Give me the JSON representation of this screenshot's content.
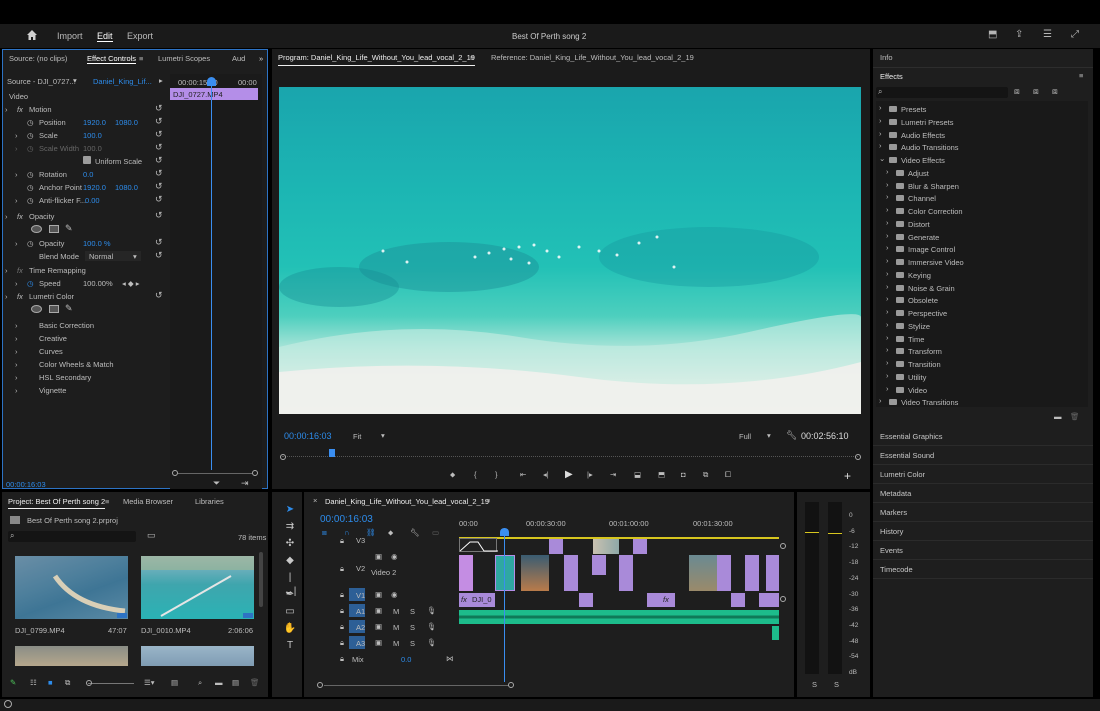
{
  "menu": {
    "import": "Import",
    "edit": "Edit",
    "export": "Export",
    "title": "Best Of Perth song 2"
  },
  "source_panel": {
    "tabs": [
      "Source: (no clips)",
      "Effect Controls",
      "Lumetri Scopes",
      "Aud"
    ],
    "source_label": "Source - DJI_0727...",
    "sequence_label": "Daniel_King_Lif...",
    "ruler_time_1": "00:00:15:00",
    "ruler_time_2": "00:00",
    "clip_name": "DJI_0727.MP4",
    "video_header": "Video",
    "motion": "Motion",
    "position_label": "Position",
    "position_x": "1920.0",
    "position_y": "1080.0",
    "scale_label": "Scale",
    "scale_val": "100.0",
    "scale_width_label": "Scale Width",
    "scale_width_val": "100.0",
    "uniform_scale": "Uniform Scale",
    "rotation_label": "Rotation",
    "rotation_val": "0.0",
    "anchor_label": "Anchor Point",
    "anchor_x": "1920.0",
    "anchor_y": "1080.0",
    "antiflicker_label": "Anti-flicker F...",
    "antiflicker_val": "0.00",
    "opacity_header": "Opacity",
    "opacity_label": "Opacity",
    "opacity_val": "100.0 %",
    "blend_label": "Blend Mode",
    "blend_val": "Normal",
    "time_remap": "Time Remapping",
    "speed_label": "Speed",
    "speed_val": "100.00%",
    "lumetri": "Lumetri Color",
    "basic": "Basic Correction",
    "creative": "Creative",
    "curves": "Curves",
    "wheels": "Color Wheels & Match",
    "hsl": "HSL Secondary",
    "vignette": "Vignette",
    "timecode": "00:00:16:03"
  },
  "program": {
    "tab": "Program: Daniel_King_Life_Without_You_lead_vocal_2_19",
    "reference_tab": "Reference: Daniel_King_Life_Without_You_lead_vocal_2_19",
    "timecode": "00:00:16:03",
    "fit": "Fit",
    "quality": "Full",
    "duration": "00:02:56:10"
  },
  "right_panel": {
    "info": "Info",
    "effects": "Effects",
    "tree": [
      {
        "label": "Presets",
        "level": 0
      },
      {
        "label": "Lumetri Presets",
        "level": 0
      },
      {
        "label": "Audio Effects",
        "level": 0
      },
      {
        "label": "Audio Transitions",
        "level": 0
      },
      {
        "label": "Video Effects",
        "level": 0,
        "open": true
      },
      {
        "label": "Adjust",
        "level": 1
      },
      {
        "label": "Blur & Sharpen",
        "level": 1
      },
      {
        "label": "Channel",
        "level": 1
      },
      {
        "label": "Color Correction",
        "level": 1
      },
      {
        "label": "Distort",
        "level": 1
      },
      {
        "label": "Generate",
        "level": 1
      },
      {
        "label": "Image Control",
        "level": 1
      },
      {
        "label": "Immersive Video",
        "level": 1
      },
      {
        "label": "Keying",
        "level": 1
      },
      {
        "label": "Noise & Grain",
        "level": 1
      },
      {
        "label": "Obsolete",
        "level": 1
      },
      {
        "label": "Perspective",
        "level": 1
      },
      {
        "label": "Stylize",
        "level": 1
      },
      {
        "label": "Time",
        "level": 1
      },
      {
        "label": "Transform",
        "level": 1
      },
      {
        "label": "Transition",
        "level": 1
      },
      {
        "label": "Utility",
        "level": 1
      },
      {
        "label": "Video",
        "level": 1
      },
      {
        "label": "Video Transitions",
        "level": 0
      }
    ],
    "panels": [
      "Essential Graphics",
      "Essential Sound",
      "Lumetri Color",
      "Metadata",
      "Markers",
      "History",
      "Events",
      "Timecode"
    ]
  },
  "project": {
    "tabs": [
      "Project: Best Of Perth song 2",
      "Media Browser",
      "Libraries"
    ],
    "file": "Best Of Perth song 2.prproj",
    "items_count": "78 items",
    "clips": [
      {
        "name": "DJI_0799.MP4",
        "duration": "47:07"
      },
      {
        "name": "DJI_0010.MP4",
        "duration": "2:06:06"
      }
    ]
  },
  "timeline": {
    "tab": "Daniel_King_Life_Without_You_lead_vocal_2_19",
    "timecode": "00:00:16:03",
    "ruler": [
      "00:00",
      "00:00:30:00",
      "00:01:00:00",
      "00:01:30:00"
    ],
    "tracks": [
      "V3",
      "V2",
      "V1",
      "A1",
      "A2",
      "A3"
    ],
    "v2_name": "Video 2",
    "mix": "Mix",
    "mix_val": "0.0",
    "clip_label_1": "DJI_0",
    "fx": "fx"
  },
  "meter": {
    "scale": [
      "0",
      "-6",
      "-12",
      "-18",
      "-24",
      "-30",
      "-36",
      "-42",
      "-48",
      "-54",
      "dB"
    ],
    "solo": [
      "S",
      "S"
    ]
  }
}
